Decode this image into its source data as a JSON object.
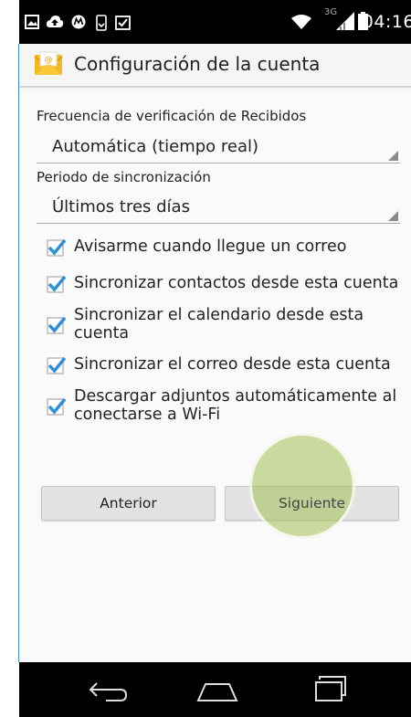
{
  "status_bar": {
    "time": "04:16",
    "network": "3G",
    "icons": [
      "gallery-icon",
      "cloud-upload-icon",
      "motorola-icon",
      "phone-update-icon",
      "task-check-icon",
      "wifi-icon",
      "signal-icon",
      "battery-icon"
    ]
  },
  "title_bar": {
    "app_icon": "email-envelope-icon",
    "title": "Configuración de la cuenta"
  },
  "form": {
    "inbox_frequency": {
      "label": "Frecuencia de verificación de Recibidos",
      "value": "Automática (tiempo real)"
    },
    "sync_period": {
      "label": "Periodo de sincronización",
      "value": "Últimos tres días"
    },
    "options": [
      {
        "label": "Avisarme cuando llegue un correo",
        "checked": true
      },
      {
        "label": "Sincronizar contactos desde esta cuenta",
        "checked": true
      },
      {
        "label": "Sincronizar el calendario desde esta cuenta",
        "checked": true
      },
      {
        "label": "Sincronizar el correo desde esta cuenta",
        "checked": true
      },
      {
        "label": "Descargar adjuntos automáticamente al conectarse a Wi-Fi",
        "checked": true
      }
    ]
  },
  "buttons": {
    "previous": "Anterior",
    "next": "Siguiente"
  },
  "colors": {
    "checkbox": "#2e8fd8",
    "ripple": "#aac35f",
    "accent_line": "#3d8fe0"
  },
  "nav_bar": {
    "icons": [
      "back-icon",
      "home-icon",
      "recent-apps-icon"
    ]
  }
}
